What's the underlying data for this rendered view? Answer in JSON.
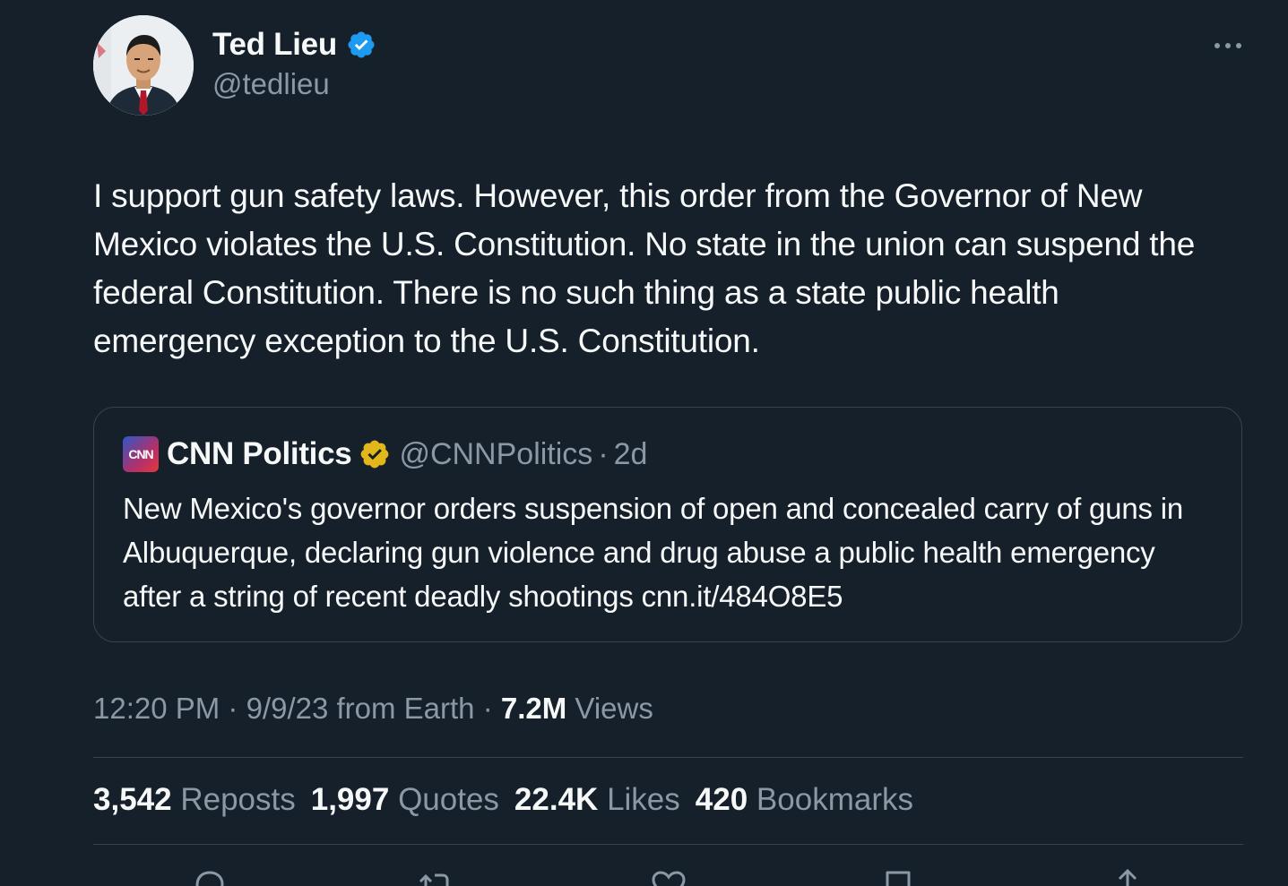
{
  "author": {
    "name": "Ted Lieu",
    "handle": "@tedlieu"
  },
  "tweet": {
    "text": "I support gun safety laws. However, this order from the Governor of New Mexico violates the U.S. Constitution. No state in the union can suspend the federal Constitution. There is no such thing as a state public health emergency exception to the U.S. Constitution."
  },
  "quote": {
    "logo_text": "CNN",
    "name": "CNN Politics",
    "handle": "@CNNPolitics",
    "separator": "·",
    "time": "2d",
    "text": "New Mexico's governor orders suspension of open and concealed carry of guns in Albuquerque, declaring gun violence and drug abuse a public health emergency after a string of recent deadly shootings cnn.it/484O8E5"
  },
  "meta": {
    "time_date_source": "12:20 PM · 9/9/23 from Earth · ",
    "views_count": "7.2M",
    "views_label": " Views"
  },
  "stats": [
    {
      "num": "3,542",
      "label": "Reposts"
    },
    {
      "num": "1,997",
      "label": "Quotes"
    },
    {
      "num": "22.4K",
      "label": "Likes"
    },
    {
      "num": "420",
      "label": "Bookmarks"
    }
  ],
  "colors": {
    "background": "#15202b",
    "text_primary": "#f7f9f9",
    "text_secondary": "#8b98a5",
    "border": "#38444d",
    "verified_blue": "#1d9bf0",
    "verified_gold": "#e2b719"
  },
  "icons": [
    "more-icon",
    "verified-badge-icon",
    "gold-verified-badge-icon",
    "reply-icon",
    "repost-icon",
    "like-icon",
    "bookmark-icon",
    "share-icon"
  ]
}
